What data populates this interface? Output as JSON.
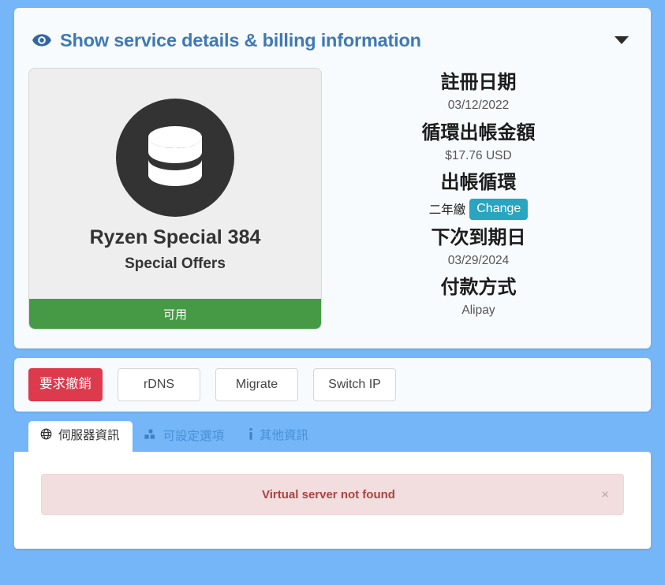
{
  "details_panel": {
    "header": {
      "title": "Show service details & billing information",
      "eye_icon": "eye-icon",
      "caret_icon": "caret-down-icon",
      "accent_color": "#3e79b5"
    },
    "product": {
      "icon": "database-icon",
      "name": "Ryzen Special 384",
      "group": "Special Offers",
      "status": "可用",
      "status_color": "#469a45"
    },
    "billing": {
      "registration_date_label": "註冊日期",
      "registration_date_value": "03/12/2022",
      "recurring_amount_label": "循環出帳金額",
      "recurring_amount_value": "$17.76 USD",
      "billing_cycle_label": "出帳循環",
      "billing_cycle_value": "二年繳",
      "change_button": "Change",
      "change_button_color": "#29a5bf",
      "next_due_date_label": "下次到期日",
      "next_due_date_value": "03/29/2024",
      "payment_method_label": "付款方式",
      "payment_method_value": "Alipay"
    }
  },
  "actions": {
    "cancel_label": "要求撤銷",
    "cancel_color": "#dd3a4d",
    "rdns_label": "rDNS",
    "migrate_label": "Migrate",
    "switch_ip_label": "Switch IP"
  },
  "tabs": [
    {
      "label": "伺服器資訊",
      "icon": "globe-icon",
      "active": true
    },
    {
      "label": "可設定選項",
      "icon": "cubes-icon",
      "active": false
    },
    {
      "label": "其他資訊",
      "icon": "info-icon",
      "active": false
    }
  ],
  "tab_content": {
    "alert_message": "Virtual server not found",
    "alert_close": "×",
    "alert_color": "#a94442"
  }
}
